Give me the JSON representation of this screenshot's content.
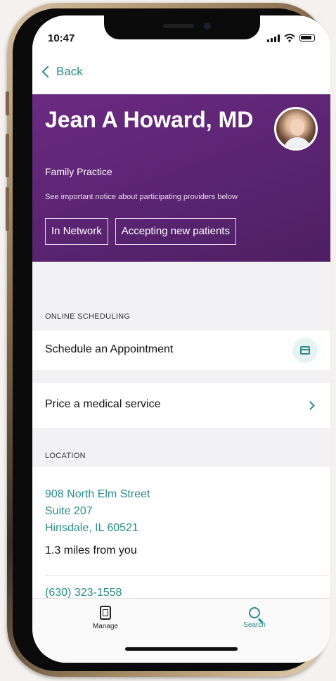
{
  "status_bar": {
    "time": "10:47"
  },
  "nav": {
    "back_label": "Back"
  },
  "provider": {
    "name": "Jean A Howard, MD",
    "specialty": "Family Practice",
    "notice": "See important notice about participating providers below",
    "tags": [
      "In Network",
      "Accepting new patients"
    ]
  },
  "scheduling": {
    "section_label": "ONLINE SCHEDULING",
    "appointment_label": "Schedule an Appointment",
    "icon": "calendar-icon"
  },
  "pricing": {
    "label": "Price a medical service",
    "icon": "chevron-right-icon"
  },
  "location": {
    "section_label": "LOCATION",
    "address_lines": [
      "908 North Elm Street",
      "Suite 207",
      "Hinsdale, IL 60521"
    ],
    "distance": "1.3 miles from you",
    "phone": "(630) 323-1558"
  },
  "tab_bar": {
    "tabs": [
      {
        "label": "Manage",
        "icon": "manage-icon",
        "active": false
      },
      {
        "label": "Search",
        "icon": "search-icon",
        "active": true
      }
    ]
  },
  "colors": {
    "accent": "#2a8c8a",
    "header_purple": "#5a2471"
  }
}
